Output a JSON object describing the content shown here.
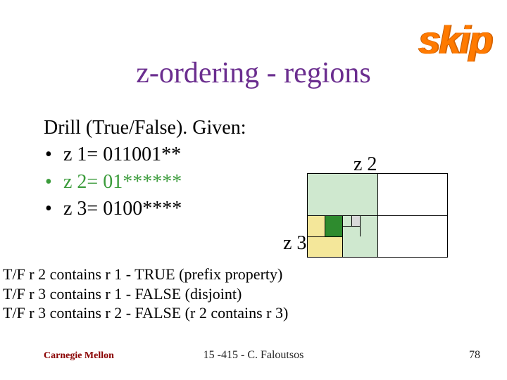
{
  "header": {
    "title": "z-ordering - regions",
    "skip": "skip"
  },
  "body": {
    "lead": "Drill (True/False). Given:",
    "items": [
      {
        "text": "z 1= 011001**",
        "green": false
      },
      {
        "text": "z 2= 01******",
        "green": true
      },
      {
        "text": "z 3= 0100****",
        "green": false
      }
    ],
    "z2": "z 2",
    "z3": "z 3"
  },
  "answers": [
    "T/F r 2 contains r 1 - TRUE (prefix property)",
    "T/F r 3 contains r 1 - FALSE (disjoint)",
    "T/F r 3 contains r 2 - FALSE (r 2 contains r 3)"
  ],
  "footer": {
    "org": "Carnegie Mellon",
    "course": "15 -415 - C. Faloutsos",
    "page": "78"
  }
}
